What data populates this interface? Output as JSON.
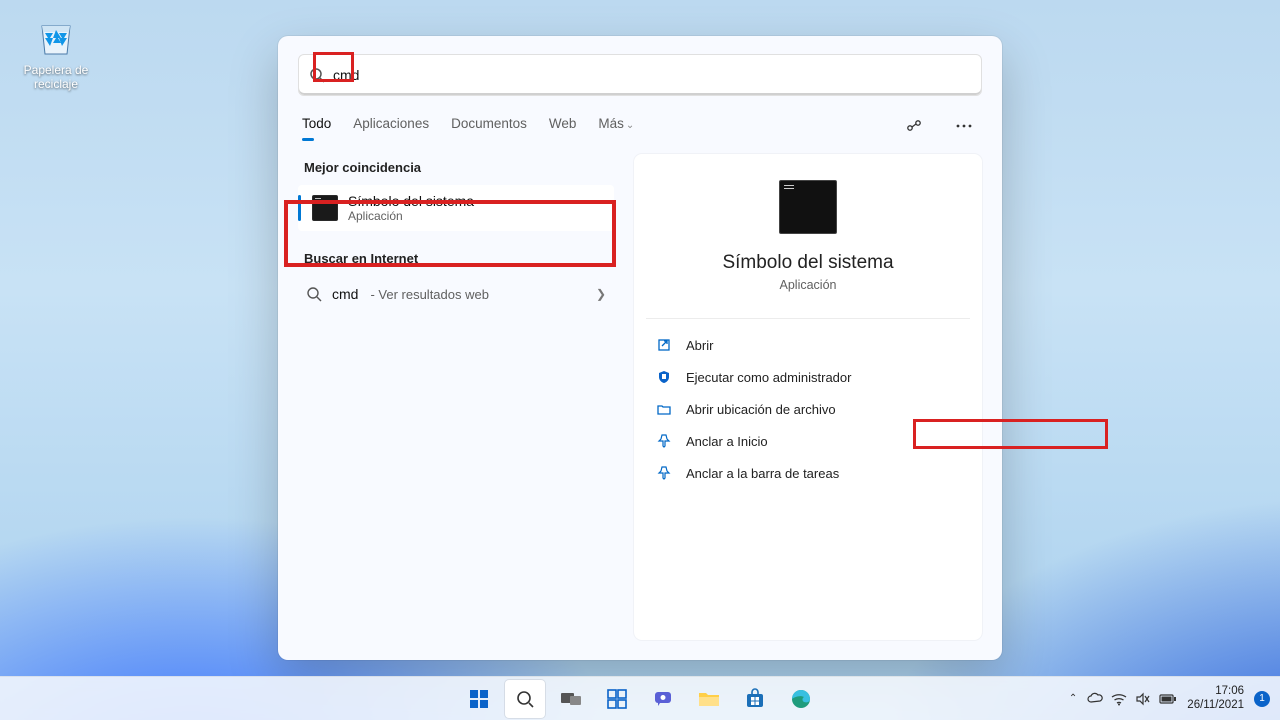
{
  "desktop": {
    "recycle_bin_label": "Papelera de reciclaje"
  },
  "search": {
    "query": "cmd",
    "tabs": {
      "all": "Todo",
      "apps": "Aplicaciones",
      "documents": "Documentos",
      "web": "Web",
      "more": "Más"
    },
    "sections": {
      "best_match": "Mejor coincidencia",
      "search_web": "Buscar en Internet"
    },
    "best_match": {
      "title": "Símbolo del sistema",
      "subtitle": "Aplicación"
    },
    "web_result": {
      "query": "cmd",
      "hint": " - Ver resultados web"
    }
  },
  "preview": {
    "title": "Símbolo del sistema",
    "subtitle": "Aplicación",
    "actions": {
      "open": "Abrir",
      "run_admin": "Ejecutar como administrador",
      "open_location": "Abrir ubicación de archivo",
      "pin_start": "Anclar a Inicio",
      "pin_taskbar": "Anclar a la barra de tareas"
    }
  },
  "taskbar": {
    "time": "17:06",
    "date": "26/11/2021",
    "notification_count": "1"
  }
}
